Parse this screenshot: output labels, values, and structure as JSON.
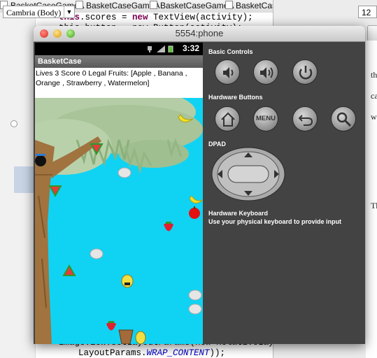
{
  "eclipse": {
    "tabs": [
      "BasketCaseGameA",
      "BasketCaseGameA",
      "BasketCaseGameA",
      "BasketCaseGameA"
    ],
    "code_line1": {
      "kw": "this",
      "rest": ".scores = ",
      "kw2": "new",
      "rest2": " TextView(activity);"
    },
    "code_line2": {
      "prefix": "this.button = new Button(activity);"
    },
    "code_bottom1": "imageView.setLayoutParams(new RelativeLayout.",
    "code_bottom2_pre": "LayoutParams.",
    "code_bottom2_const": "WRAP_CONTENT",
    "code_bottom2_post": "));"
  },
  "word": {
    "font_name": "Cambria (Body)",
    "font_size": "12",
    "doc_fragments": [
      "th",
      "ca",
      "w",
      "Th"
    ]
  },
  "emulator": {
    "window_title": "5554:phone",
    "status_time": "3:32",
    "app_title": "BasketCase",
    "scores_text": "Lives 3  Score 0 Legal Fruits: [Apple , Banana , Orange , Strawberry , Watermelon]",
    "controls": {
      "basic_label": "Basic Controls",
      "hardware_label": "Hardware Buttons",
      "menu_label": "MENU",
      "dpad_label": "DPAD",
      "keyboard_title": "Hardware Keyboard",
      "keyboard_hint": "Use your physical keyboard to provide input"
    }
  },
  "colors": {
    "sky": "#10d3f4",
    "tree_trunk": "#a0733f",
    "leaves": "#b8d0a8",
    "emulator_bg": "#434343"
  },
  "icons": [
    "volume-down-icon",
    "volume-up-icon",
    "power-icon",
    "home-icon",
    "back-icon",
    "search-icon",
    "dpad-icon"
  ]
}
